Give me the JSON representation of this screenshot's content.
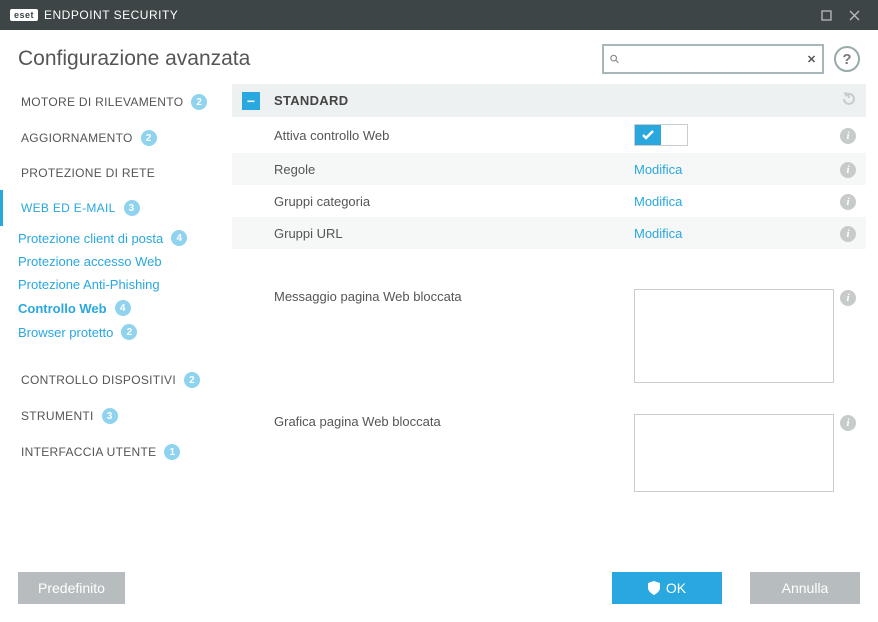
{
  "titlebar": {
    "brand_logo": "eset",
    "brand_text": "ENDPOINT SECURITY"
  },
  "header": {
    "title": "Configurazione avanzata",
    "search_placeholder": "",
    "help": "?"
  },
  "sidebar": {
    "items": [
      {
        "label": "MOTORE DI RILEVAMENTO",
        "badge": "2"
      },
      {
        "label": "AGGIORNAMENTO",
        "badge": "2"
      },
      {
        "label": "PROTEZIONE DI RETE",
        "badge": ""
      },
      {
        "label": "WEB ED E-MAIL",
        "badge": "3"
      },
      {
        "label": "CONTROLLO DISPOSITIVI",
        "badge": "2"
      },
      {
        "label": "STRUMENTI",
        "badge": "3"
      },
      {
        "label": "INTERFACCIA UTENTE",
        "badge": "1"
      }
    ],
    "subs": [
      {
        "label": "Protezione client di posta",
        "badge": "4"
      },
      {
        "label": "Protezione accesso Web",
        "badge": ""
      },
      {
        "label": "Protezione Anti-Phishing",
        "badge": ""
      },
      {
        "label": "Controllo Web",
        "badge": "4"
      },
      {
        "label": "Browser protetto",
        "badge": "2"
      }
    ]
  },
  "section": {
    "title": "STANDARD",
    "rows": {
      "enable": {
        "label": "Attiva controllo Web"
      },
      "rules": {
        "label": "Regole",
        "action": "Modifica"
      },
      "catgroups": {
        "label": "Gruppi categoria",
        "action": "Modifica"
      },
      "urlgroups": {
        "label": "Gruppi URL",
        "action": "Modifica"
      },
      "blockedmsg": {
        "label": "Messaggio pagina Web bloccata"
      },
      "blockedimg": {
        "label": "Grafica pagina Web bloccata"
      }
    }
  },
  "footer": {
    "default": "Predefinito",
    "ok": "OK",
    "cancel": "Annulla"
  }
}
